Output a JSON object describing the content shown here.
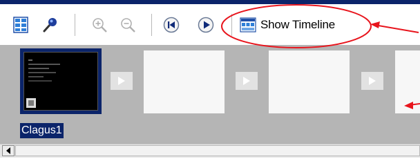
{
  "toolbar": {
    "show_timeline_label": "Show Timeline",
    "icons": [
      "storyboard-icon",
      "effects-icon",
      "zoom-in-icon",
      "zoom-out-icon",
      "rewind-icon",
      "play-icon",
      "timeline-icon"
    ]
  },
  "storyboard": {
    "clips": [
      {
        "name": "Clagus1",
        "selected": true
      }
    ]
  },
  "annotation": {
    "color": "#e8151d"
  }
}
